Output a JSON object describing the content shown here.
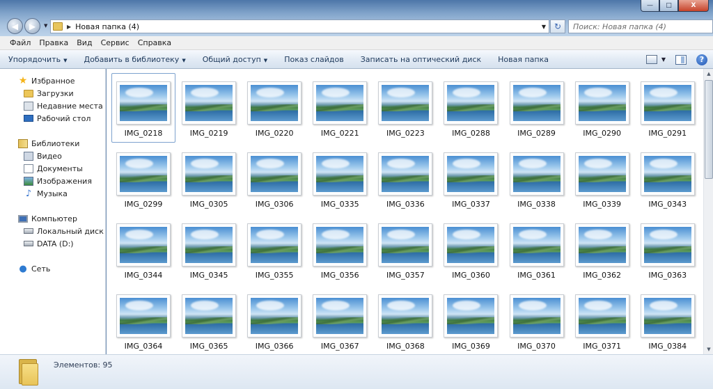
{
  "window": {
    "controls": {
      "minimize": "—",
      "maximize": "□",
      "close": "X"
    }
  },
  "address": {
    "path": "Новая папка (4)",
    "search_placeholder": "Поиск: Новая папка (4)"
  },
  "menu": [
    "Файл",
    "Правка",
    "Вид",
    "Сервис",
    "Справка"
  ],
  "commands": [
    {
      "label": "Упорядочить",
      "dropdown": true
    },
    {
      "label": "Добавить в библиотеку",
      "dropdown": true
    },
    {
      "label": "Общий доступ",
      "dropdown": true
    },
    {
      "label": "Показ слайдов",
      "dropdown": false
    },
    {
      "label": "Записать на оптический диск",
      "dropdown": false
    },
    {
      "label": "Новая папка",
      "dropdown": false
    }
  ],
  "nav": {
    "groups": [
      {
        "label": "Избранное",
        "icon": "star-icon",
        "items": [
          {
            "label": "Загрузки",
            "icon": "downloads-folder-icon"
          },
          {
            "label": "Недавние места",
            "icon": "recent-places-icon"
          },
          {
            "label": "Рабочий стол",
            "icon": "desktop-icon"
          }
        ]
      },
      {
        "label": "Библиотеки",
        "icon": "libraries-icon",
        "items": [
          {
            "label": "Видео",
            "icon": "video-icon"
          },
          {
            "label": "Документы",
            "icon": "documents-icon"
          },
          {
            "label": "Изображения",
            "icon": "pictures-icon"
          },
          {
            "label": "Музыка",
            "icon": "music-icon"
          }
        ]
      },
      {
        "label": "Компьютер",
        "icon": "computer-icon",
        "items": [
          {
            "label": "Локальный диск (C",
            "icon": "local-disk-icon"
          },
          {
            "label": "DATA (D:)",
            "icon": "drive-icon"
          }
        ]
      },
      {
        "label": "Сеть",
        "icon": "network-icon",
        "items": []
      }
    ]
  },
  "files": [
    "IMG_0218",
    "IMG_0219",
    "IMG_0220",
    "IMG_0221",
    "IMG_0223",
    "IMG_0288",
    "IMG_0289",
    "IMG_0290",
    "IMG_0291",
    "IMG_0299",
    "IMG_0305",
    "IMG_0306",
    "IMG_0335",
    "IMG_0336",
    "IMG_0337",
    "IMG_0338",
    "IMG_0339",
    "IMG_0343",
    "IMG_0344",
    "IMG_0345",
    "IMG_0355",
    "IMG_0356",
    "IMG_0357",
    "IMG_0360",
    "IMG_0361",
    "IMG_0362",
    "IMG_0363",
    "IMG_0364",
    "IMG_0365",
    "IMG_0366",
    "IMG_0367",
    "IMG_0368",
    "IMG_0369",
    "IMG_0370",
    "IMG_0371",
    "IMG_0384"
  ],
  "selected_file": "IMG_0218",
  "details": {
    "count_text": "Элементов: 95"
  },
  "colors": {
    "accent": "#1e395b",
    "selection_border": "#7da2ce",
    "folder": "#ecc659"
  }
}
